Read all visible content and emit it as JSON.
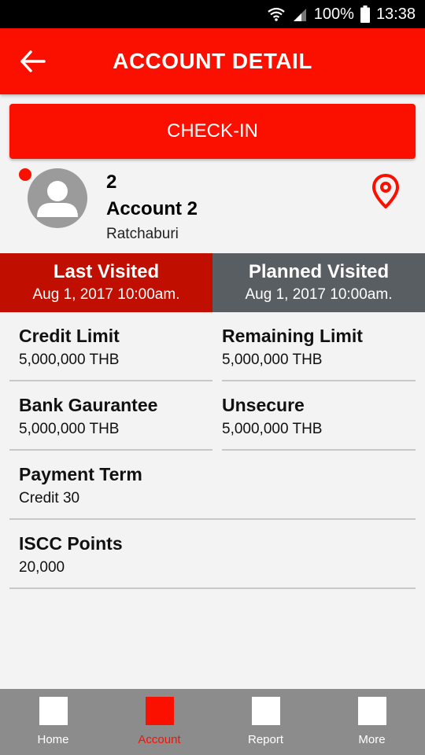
{
  "status_bar": {
    "battery": "100%",
    "time": "13:38"
  },
  "header": {
    "title": "ACCOUNT DETAIL",
    "back_icon": "arrow-left-icon"
  },
  "checkin": {
    "label": "CHECK-IN"
  },
  "account": {
    "number": "2",
    "name": "Account 2",
    "location": "Ratchaburi"
  },
  "visits": {
    "last": {
      "label": "Last Visited",
      "date": "Aug 1, 2017 10:00am."
    },
    "planned": {
      "label": "Planned Visited",
      "date": "Aug 1, 2017 10:00am."
    }
  },
  "details": {
    "credit_limit": {
      "label": "Credit Limit",
      "value": "5,000,000 THB"
    },
    "remaining_limit": {
      "label": "Remaining Limit",
      "value": "5,000,000 THB"
    },
    "bank_guarantee": {
      "label": "Bank Gaurantee",
      "value": "5,000,000 THB"
    },
    "unsecure": {
      "label": "Unsecure",
      "value": "5,000,000 THB"
    },
    "payment_term": {
      "label": "Payment Term",
      "value": "Credit 30"
    },
    "iscc_points": {
      "label": "ISCC Points",
      "value": "20,000"
    }
  },
  "nav": {
    "items": [
      {
        "label": "Home",
        "active": false
      },
      {
        "label": "Account",
        "active": true
      },
      {
        "label": "Report",
        "active": false
      },
      {
        "label": "More",
        "active": false
      }
    ]
  },
  "colors": {
    "accent": "#fb1000",
    "last_visited_bg": "#c00f00",
    "planned_visited_bg": "#595e62",
    "nav_bg": "#8c8c8c"
  }
}
